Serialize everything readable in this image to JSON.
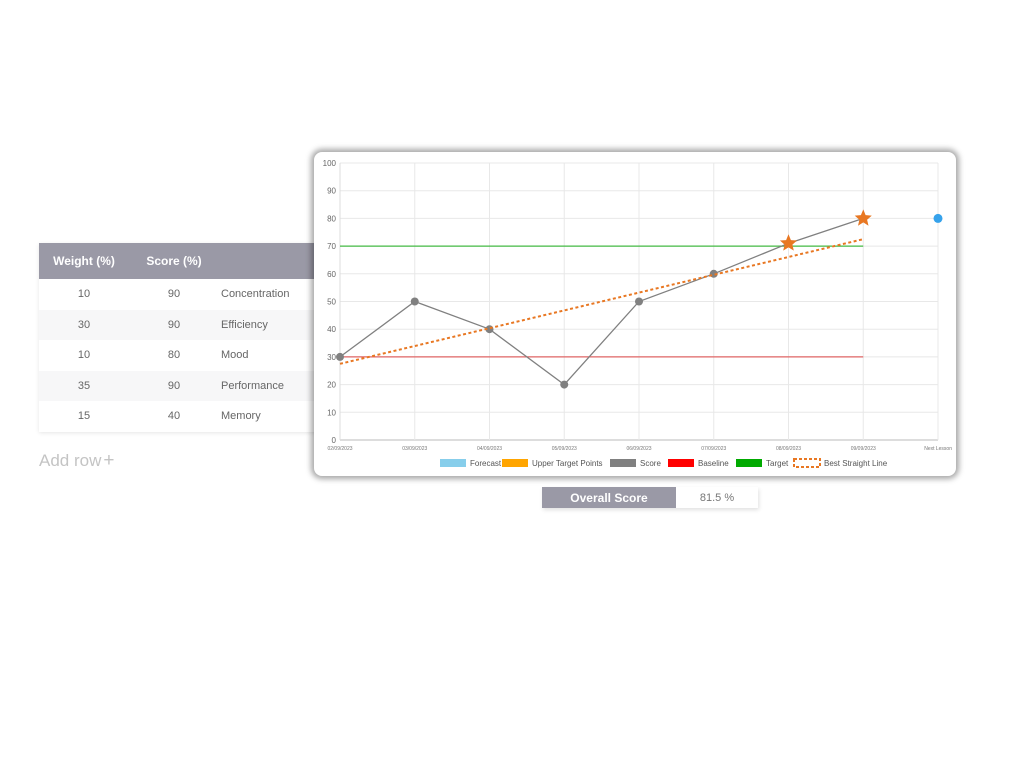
{
  "table": {
    "headers": [
      "Weight (%)",
      "Score (%)",
      ""
    ],
    "rows": [
      {
        "weight": "10",
        "score": "90",
        "category": "Concentration"
      },
      {
        "weight": "30",
        "score": "90",
        "category": "Efficiency"
      },
      {
        "weight": "10",
        "score": "80",
        "category": "Mood"
      },
      {
        "weight": "35",
        "score": "90",
        "category": "Performance"
      },
      {
        "weight": "15",
        "score": "40",
        "category": "Memory"
      }
    ],
    "add_row_label": "Add row",
    "add_row_icon": "+"
  },
  "overall": {
    "label": "Overall Score",
    "value": "81.5 %"
  },
  "chart_data": {
    "type": "line",
    "categories": [
      "02/09/2023",
      "03/09/2023",
      "04/09/2023",
      "05/09/2023",
      "06/09/2023",
      "07/09/2023",
      "08/09/2023",
      "09/09/2023",
      "Next Lesson"
    ],
    "ylim": [
      0,
      100
    ],
    "yticks": [
      0,
      10,
      20,
      30,
      40,
      50,
      60,
      70,
      80,
      90,
      100
    ],
    "grid": true,
    "legend_position": "bottom",
    "series": [
      {
        "name": "Forecast",
        "color": "#87ceeb",
        "type": "point",
        "values": [
          null,
          null,
          null,
          null,
          null,
          null,
          null,
          null,
          80
        ],
        "point_color": "#36a2eb"
      },
      {
        "name": "Upper Target Points",
        "color": "#ffa500",
        "type": "star",
        "values": [
          null,
          null,
          null,
          null,
          null,
          null,
          71,
          80,
          null
        ],
        "point_color": "#e87722"
      },
      {
        "name": "Score",
        "color": "#808080",
        "type": "line",
        "values": [
          30,
          50,
          40,
          20,
          50,
          60,
          71,
          80,
          null
        ]
      },
      {
        "name": "Baseline",
        "color": "#ff0000",
        "line_color": "#e06666",
        "type": "flat",
        "values": [
          30,
          30,
          30,
          30,
          30,
          30,
          30,
          30,
          null
        ]
      },
      {
        "name": "Target",
        "color": "#00aa00",
        "line_color": "#44bb44",
        "type": "flat",
        "values": [
          70,
          70,
          70,
          70,
          70,
          70,
          70,
          70,
          null
        ]
      },
      {
        "name": "Best Straight Line",
        "color": "#e87722",
        "type": "dashed",
        "start": 27.5,
        "end": 72.5
      }
    ]
  }
}
